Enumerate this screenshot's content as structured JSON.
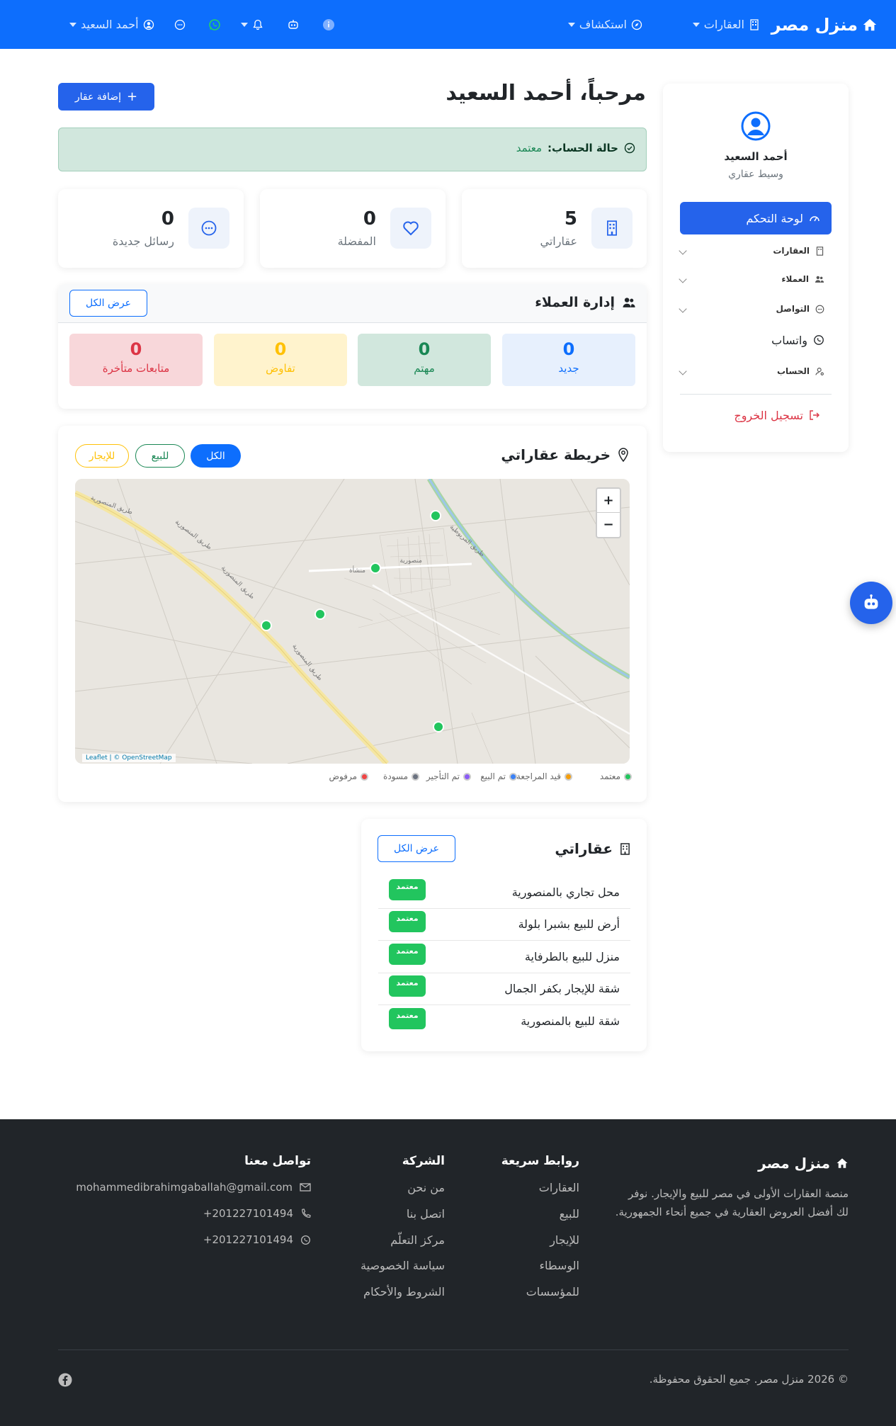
{
  "navbar": {
    "brand": "منزل مصر",
    "properties": "العقارات",
    "explore": "استكشاف",
    "user": "أحمد السعيد",
    "icons": [
      "home-icon",
      "building-icon",
      "compass-icon",
      "info-icon",
      "robot-icon",
      "bell-icon",
      "whatsapp-icon",
      "chat-icon",
      "user-circle-icon"
    ]
  },
  "sidebar": {
    "name": "أحمد السعيد",
    "role": "وسيط عقاري",
    "dashboard": "لوحة التحكم",
    "items": [
      "العقارات",
      "العملاء",
      "التواصل"
    ],
    "whatsapp": "واتساب",
    "account": "الحساب",
    "logout": "تسجيل الخروج"
  },
  "main": {
    "welcome": "مرحباً، أحمد السعيد",
    "add_property": "إضافة عقار",
    "status_label": "حالة الحساب:",
    "status_value": "معتمد"
  },
  "stats": [
    {
      "value": "5",
      "label": "عقاراتي",
      "icon": "building-icon"
    },
    {
      "value": "0",
      "label": "المفضلة",
      "icon": "heart-icon"
    },
    {
      "value": "0",
      "label": "رسائل جديدة",
      "icon": "chat-icon"
    }
  ],
  "clients": {
    "title": "إدارة العملاء",
    "view_all": "عرض الكل",
    "boxes": [
      {
        "value": "0",
        "label": "جديد",
        "bg": "#e7f0fd",
        "color": "#0d6efd"
      },
      {
        "value": "0",
        "label": "مهتم",
        "bg": "#d1e7dd",
        "color": "#198754"
      },
      {
        "value": "0",
        "label": "تفاوض",
        "bg": "#fff3cd",
        "color": "#ffc107"
      },
      {
        "value": "0",
        "label": "متابعات متأخرة",
        "bg": "#f8d7da",
        "color": "#dc3545"
      }
    ]
  },
  "map": {
    "title": "خريطة عقاراتي",
    "filters": [
      "الكل",
      "للبيع",
      "للإيجار"
    ],
    "zoom_in": "+",
    "zoom_out": "−",
    "attribution": "Leaflet | © OpenStreetMap",
    "place_labels": [
      "منصورية",
      "منشأة",
      "طريق المنصورية",
      "طريق المنصورية",
      "طريق المنصورية",
      "طريق المنصورية",
      "طريق المريوطية"
    ],
    "legend": [
      {
        "label": "معتمد",
        "color": "#22c55e"
      },
      {
        "label": "قيد المراجعة",
        "color": "#f59e0b"
      },
      {
        "label": "تم البيع",
        "color": "#3b82f6"
      },
      {
        "label": "تم التأجير",
        "color": "#8b5cf6"
      },
      {
        "label": "مسودة",
        "color": "#6b7280"
      },
      {
        "label": "مرفوض",
        "color": "#ef4444"
      }
    ]
  },
  "properties": {
    "title": "عقاراتي",
    "view_all": "عرض الكل",
    "badge": "معتمد",
    "items": [
      "محل تجاري بالمنصورية",
      "أرض للبيع بشبرا بلولة",
      "منزل للبيع بالطرفاية",
      "شقة للإيجار بكفر الجمال",
      "شقة للبيع بالمنصورية"
    ]
  },
  "footer": {
    "brand": "منزل مصر",
    "about": "منصة العقارات الأولى في مصر للبيع والإيجار. نوفر لك أفضل العروض العقارية في جميع أنحاء الجمهورية.",
    "quick_title": "روابط سريعة",
    "quick_links": [
      "العقارات",
      "للبيع",
      "للإيجار",
      "الوسطاء",
      "للمؤسسات"
    ],
    "company_title": "الشركة",
    "company_links": [
      "من نحن",
      "اتصل بنا",
      "مركز التعلّم",
      "سياسة الخصوصية",
      "الشروط والأحكام"
    ],
    "contact_title": "تواصل معنا",
    "email": "mohammedibrahimgaballah@gmail.com",
    "phone": "201227101494+",
    "whatsapp": "201227101494+",
    "copyright": "© 2026 منزل مصر. جميع الحقوق محفوظة."
  }
}
